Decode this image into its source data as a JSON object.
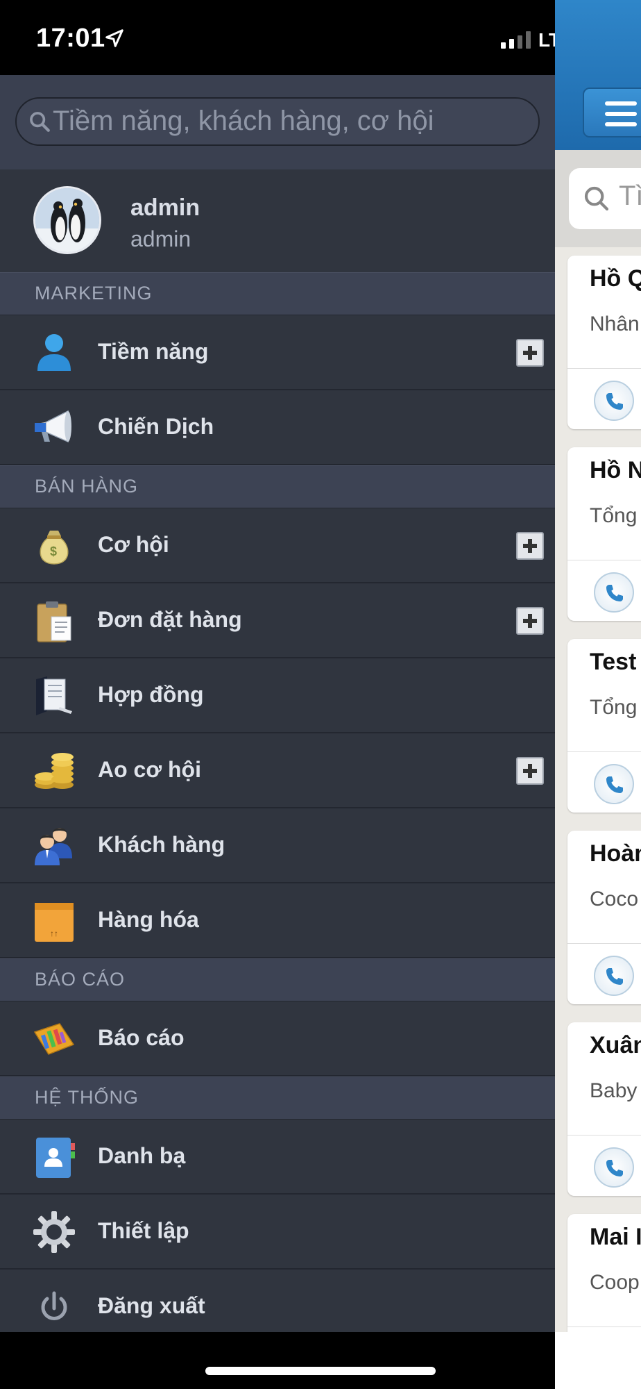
{
  "status_bar": {
    "time": "17:01",
    "network": "LTE"
  },
  "menu": {
    "search_placeholder": "Tiềm năng, khách hàng, cơ hội",
    "profile": {
      "name": "admin",
      "role": "admin"
    },
    "sections": {
      "marketing": "MARKETING",
      "sales": "BÁN HÀNG",
      "reports": "BÁO CÁO",
      "system": "HỆ THỐNG"
    },
    "items": {
      "leads": "Tiềm năng",
      "campaigns": "Chiến Dịch",
      "opportunities": "Cơ hội",
      "orders": "Đơn đặt hàng",
      "contracts": "Hợp đồng",
      "opportunity_pool": "Ao cơ hội",
      "customers": "Khách hàng",
      "products": "Hàng hóa",
      "reports": "Báo cáo",
      "contacts": "Danh bạ",
      "settings": "Thiết lập",
      "logout": "Đăng xuất"
    }
  },
  "content": {
    "search_placeholder": "Tì",
    "cards": [
      {
        "name": "Hồ Q",
        "sub": "Nhân"
      },
      {
        "name": "Hồ N",
        "sub": "Tổng"
      },
      {
        "name": "Test",
        "sub": "Tổng"
      },
      {
        "name": "Hoàn",
        "sub": "Coco"
      },
      {
        "name": "Xuân",
        "sub": "Baby"
      },
      {
        "name": "Mai I",
        "sub": "Coop"
      }
    ]
  },
  "icons": {
    "status": [
      "location-arrow-icon",
      "signal-icon",
      "battery-icon"
    ],
    "menu": [
      "search-icon",
      "person-icon",
      "megaphone-icon",
      "money-bag-icon",
      "clipboard-icon",
      "contract-icon",
      "coins-icon",
      "customers-icon",
      "box-icon",
      "report-book-icon",
      "address-book-icon",
      "gear-icon",
      "power-icon",
      "plus-icon"
    ],
    "content": [
      "menu-icon",
      "search-icon",
      "phone-icon"
    ]
  }
}
